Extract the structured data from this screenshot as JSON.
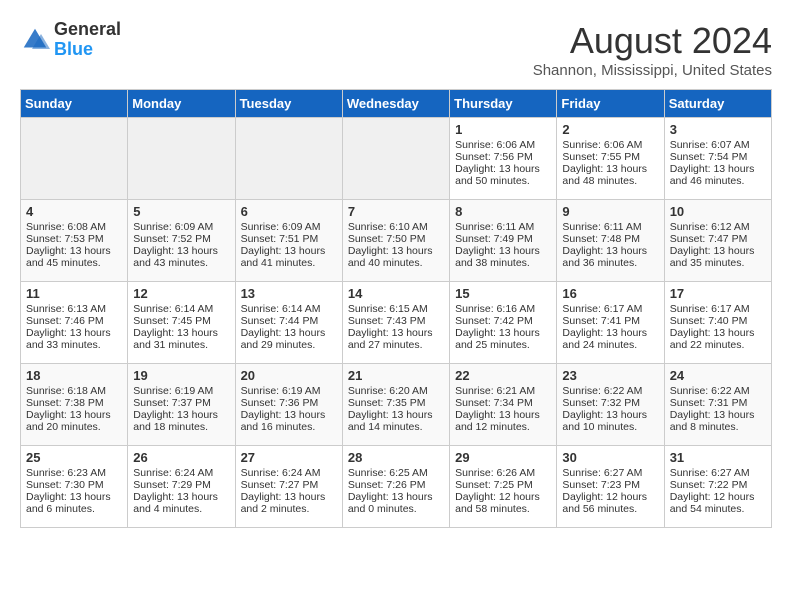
{
  "logo": {
    "general": "General",
    "blue": "Blue"
  },
  "title": "August 2024",
  "subtitle": "Shannon, Mississippi, United States",
  "days_of_week": [
    "Sunday",
    "Monday",
    "Tuesday",
    "Wednesday",
    "Thursday",
    "Friday",
    "Saturday"
  ],
  "weeks": [
    [
      {
        "day": "",
        "content": ""
      },
      {
        "day": "",
        "content": ""
      },
      {
        "day": "",
        "content": ""
      },
      {
        "day": "",
        "content": ""
      },
      {
        "day": "1",
        "content": "Sunrise: 6:06 AM\nSunset: 7:56 PM\nDaylight: 13 hours\nand 50 minutes."
      },
      {
        "day": "2",
        "content": "Sunrise: 6:06 AM\nSunset: 7:55 PM\nDaylight: 13 hours\nand 48 minutes."
      },
      {
        "day": "3",
        "content": "Sunrise: 6:07 AM\nSunset: 7:54 PM\nDaylight: 13 hours\nand 46 minutes."
      }
    ],
    [
      {
        "day": "4",
        "content": "Sunrise: 6:08 AM\nSunset: 7:53 PM\nDaylight: 13 hours\nand 45 minutes."
      },
      {
        "day": "5",
        "content": "Sunrise: 6:09 AM\nSunset: 7:52 PM\nDaylight: 13 hours\nand 43 minutes."
      },
      {
        "day": "6",
        "content": "Sunrise: 6:09 AM\nSunset: 7:51 PM\nDaylight: 13 hours\nand 41 minutes."
      },
      {
        "day": "7",
        "content": "Sunrise: 6:10 AM\nSunset: 7:50 PM\nDaylight: 13 hours\nand 40 minutes."
      },
      {
        "day": "8",
        "content": "Sunrise: 6:11 AM\nSunset: 7:49 PM\nDaylight: 13 hours\nand 38 minutes."
      },
      {
        "day": "9",
        "content": "Sunrise: 6:11 AM\nSunset: 7:48 PM\nDaylight: 13 hours\nand 36 minutes."
      },
      {
        "day": "10",
        "content": "Sunrise: 6:12 AM\nSunset: 7:47 PM\nDaylight: 13 hours\nand 35 minutes."
      }
    ],
    [
      {
        "day": "11",
        "content": "Sunrise: 6:13 AM\nSunset: 7:46 PM\nDaylight: 13 hours\nand 33 minutes."
      },
      {
        "day": "12",
        "content": "Sunrise: 6:14 AM\nSunset: 7:45 PM\nDaylight: 13 hours\nand 31 minutes."
      },
      {
        "day": "13",
        "content": "Sunrise: 6:14 AM\nSunset: 7:44 PM\nDaylight: 13 hours\nand 29 minutes."
      },
      {
        "day": "14",
        "content": "Sunrise: 6:15 AM\nSunset: 7:43 PM\nDaylight: 13 hours\nand 27 minutes."
      },
      {
        "day": "15",
        "content": "Sunrise: 6:16 AM\nSunset: 7:42 PM\nDaylight: 13 hours\nand 25 minutes."
      },
      {
        "day": "16",
        "content": "Sunrise: 6:17 AM\nSunset: 7:41 PM\nDaylight: 13 hours\nand 24 minutes."
      },
      {
        "day": "17",
        "content": "Sunrise: 6:17 AM\nSunset: 7:40 PM\nDaylight: 13 hours\nand 22 minutes."
      }
    ],
    [
      {
        "day": "18",
        "content": "Sunrise: 6:18 AM\nSunset: 7:38 PM\nDaylight: 13 hours\nand 20 minutes."
      },
      {
        "day": "19",
        "content": "Sunrise: 6:19 AM\nSunset: 7:37 PM\nDaylight: 13 hours\nand 18 minutes."
      },
      {
        "day": "20",
        "content": "Sunrise: 6:19 AM\nSunset: 7:36 PM\nDaylight: 13 hours\nand 16 minutes."
      },
      {
        "day": "21",
        "content": "Sunrise: 6:20 AM\nSunset: 7:35 PM\nDaylight: 13 hours\nand 14 minutes."
      },
      {
        "day": "22",
        "content": "Sunrise: 6:21 AM\nSunset: 7:34 PM\nDaylight: 13 hours\nand 12 minutes."
      },
      {
        "day": "23",
        "content": "Sunrise: 6:22 AM\nSunset: 7:32 PM\nDaylight: 13 hours\nand 10 minutes."
      },
      {
        "day": "24",
        "content": "Sunrise: 6:22 AM\nSunset: 7:31 PM\nDaylight: 13 hours\nand 8 minutes."
      }
    ],
    [
      {
        "day": "25",
        "content": "Sunrise: 6:23 AM\nSunset: 7:30 PM\nDaylight: 13 hours\nand 6 minutes."
      },
      {
        "day": "26",
        "content": "Sunrise: 6:24 AM\nSunset: 7:29 PM\nDaylight: 13 hours\nand 4 minutes."
      },
      {
        "day": "27",
        "content": "Sunrise: 6:24 AM\nSunset: 7:27 PM\nDaylight: 13 hours\nand 2 minutes."
      },
      {
        "day": "28",
        "content": "Sunrise: 6:25 AM\nSunset: 7:26 PM\nDaylight: 13 hours\nand 0 minutes."
      },
      {
        "day": "29",
        "content": "Sunrise: 6:26 AM\nSunset: 7:25 PM\nDaylight: 12 hours\nand 58 minutes."
      },
      {
        "day": "30",
        "content": "Sunrise: 6:27 AM\nSunset: 7:23 PM\nDaylight: 12 hours\nand 56 minutes."
      },
      {
        "day": "31",
        "content": "Sunrise: 6:27 AM\nSunset: 7:22 PM\nDaylight: 12 hours\nand 54 minutes."
      }
    ]
  ]
}
